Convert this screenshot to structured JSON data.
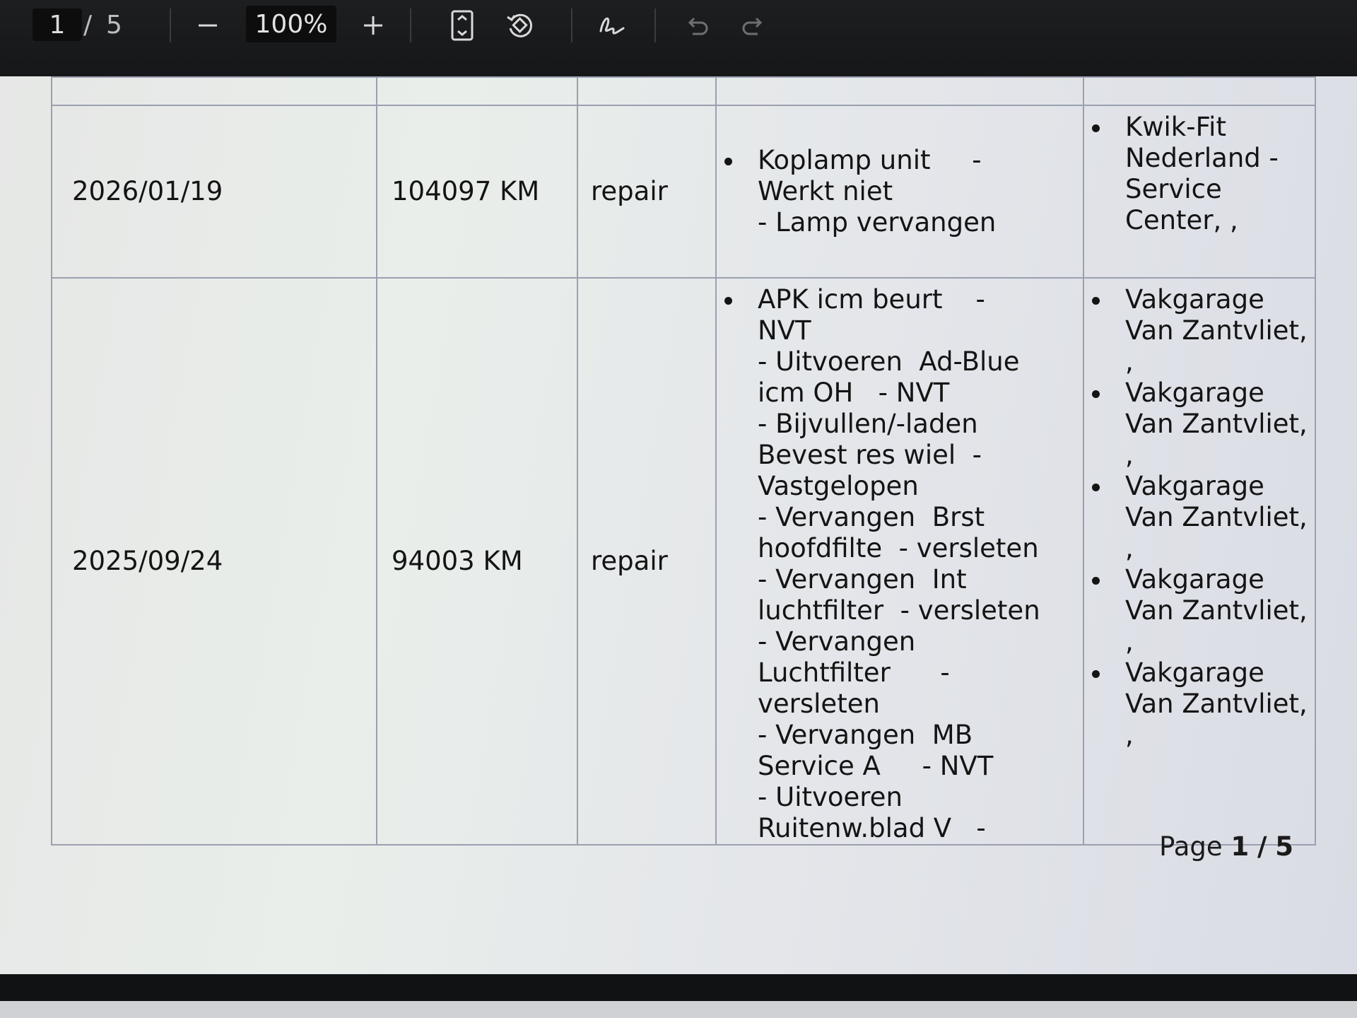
{
  "toolbar": {
    "current_page": "1",
    "page_separator": "/",
    "total_pages": "5",
    "zoom_out_icon": "minus",
    "zoom_level": "100%",
    "zoom_in_icon": "plus",
    "fit_page_icon": "fit-to-page",
    "rotate_icon": "rotate",
    "annotate_icon": "signature",
    "undo_icon": "undo",
    "redo_icon": "redo"
  },
  "table": {
    "rows": [
      {
        "date": "2026/01/19",
        "mileage": "104097 KM",
        "type": "repair",
        "description_lines": [
          "Koplamp unit     -",
          "Werkt niet",
          "- Lamp vervangen"
        ],
        "garages": [
          "Kwik-Fit Nederland - Service Center, ,"
        ]
      },
      {
        "date": "2025/09/24",
        "mileage": "94003 KM",
        "type": "repair",
        "description_lines": [
          "APK icm beurt    -",
          "NVT",
          "- Uitvoeren  Ad-Blue",
          "icm OH   - NVT",
          "- Bijvullen/-laden",
          "Bevest res wiel  -",
          "Vastgelopen",
          "- Vervangen  Brst",
          "hoofdfilte  - versleten",
          "- Vervangen  Int",
          "luchtfilter  - versleten",
          "- Vervangen",
          "Luchtfilter      -",
          "versleten",
          "- Vervangen  MB",
          "Service A     - NVT",
          "- Uitvoeren",
          "Ruitenw.blad V   -"
        ],
        "garages": [
          "Vakgarage Van Zantvliet, ,",
          "Vakgarage Van Zantvliet, ,",
          "Vakgarage Van Zantvliet, ,",
          "Vakgarage Van Zantvliet, ,",
          "Vakgarage Van Zantvliet, ,"
        ]
      }
    ]
  },
  "footer": {
    "page_label": "Page",
    "page_current": "1",
    "page_separator": "/",
    "page_total": "5"
  }
}
